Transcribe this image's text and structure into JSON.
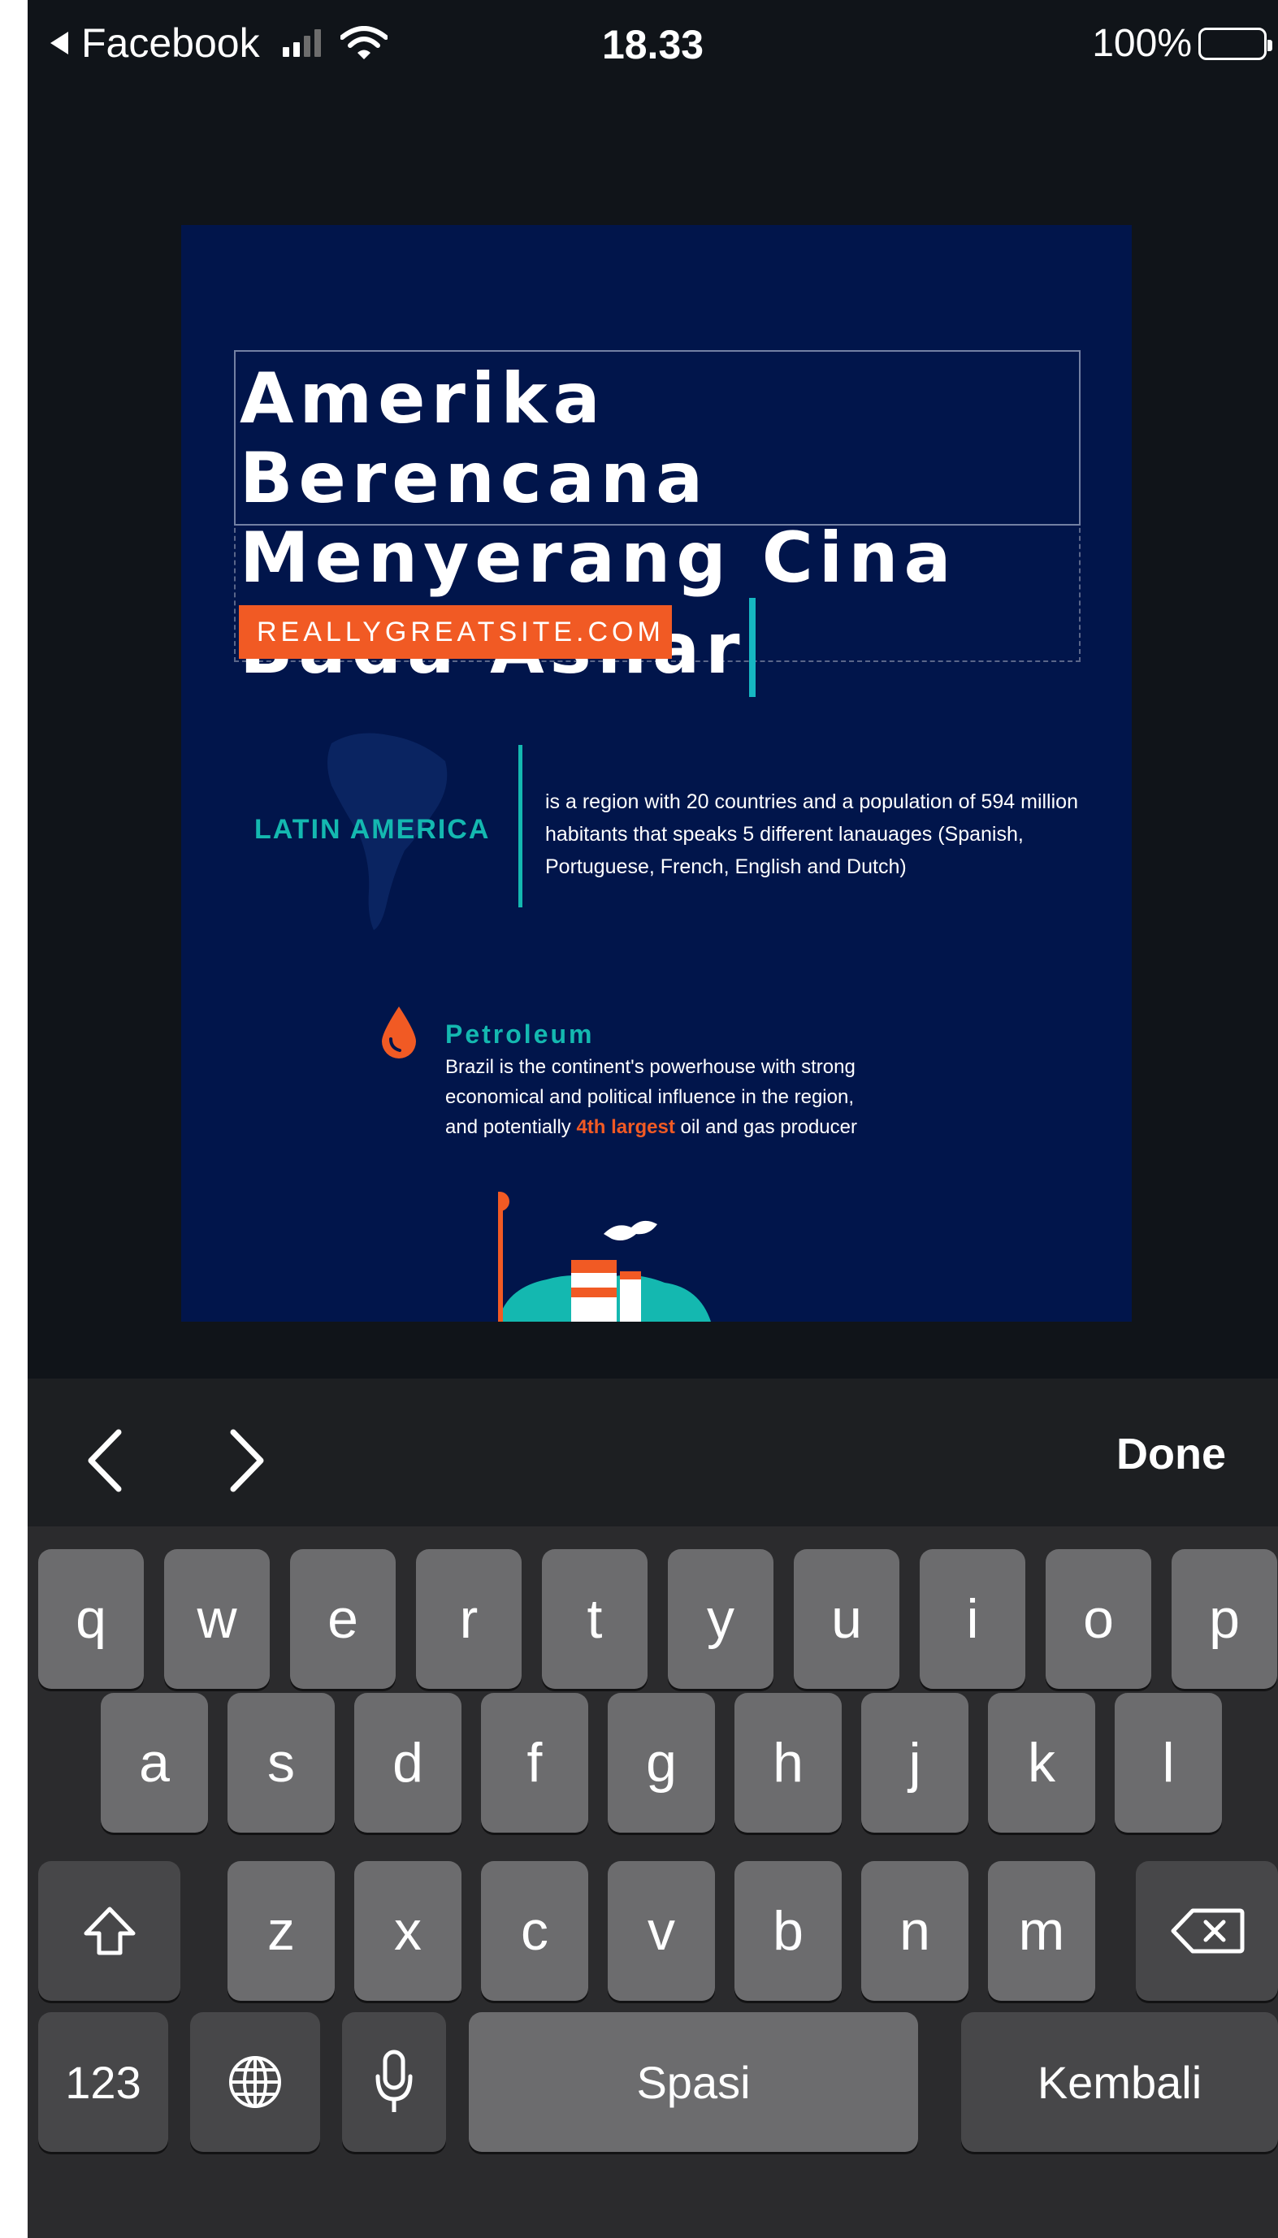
{
  "status_bar": {
    "back_app": "Facebook",
    "time": "18.33",
    "battery": "100%"
  },
  "design": {
    "headline": "Amerika Berencana Menyerang Cina Bada Ashar",
    "website": "REALLYGREATSITE.COM",
    "region_title": "LATIN AMERICA",
    "region_text": "is a region with 20 countries and a population of 594 million habitants that speaks 5 different lanauages (Spanish, Portuguese, French, English and Dutch)",
    "section_title": "Petroleum",
    "section_text": "Brazil is the continent's powerhouse with strong economical and political influence in the region, and potentially",
    "section_highlight": "4th largest",
    "section_text_end": "oil and gas producer",
    "colors": {
      "background": "#01154b",
      "accent_orange": "#f15a24",
      "accent_teal": "#14b8b0"
    }
  },
  "toolbar": {
    "prev_icon": "chevron-left-icon",
    "next_icon": "chevron-right-icon",
    "done_label": "Done"
  },
  "keyboard": {
    "row1": [
      "q",
      "w",
      "e",
      "r",
      "t",
      "y",
      "u",
      "i",
      "o",
      "p"
    ],
    "row2": [
      "a",
      "s",
      "d",
      "f",
      "g",
      "h",
      "j",
      "k",
      "l"
    ],
    "row3": [
      "z",
      "x",
      "c",
      "v",
      "b",
      "n",
      "m"
    ],
    "shift_icon": "shift-icon",
    "delete_icon": "delete-icon",
    "numbers_label": "123",
    "globe_icon": "globe-icon",
    "mic_icon": "microphone-icon",
    "space_label": "Spasi",
    "return_label": "Kembali"
  }
}
